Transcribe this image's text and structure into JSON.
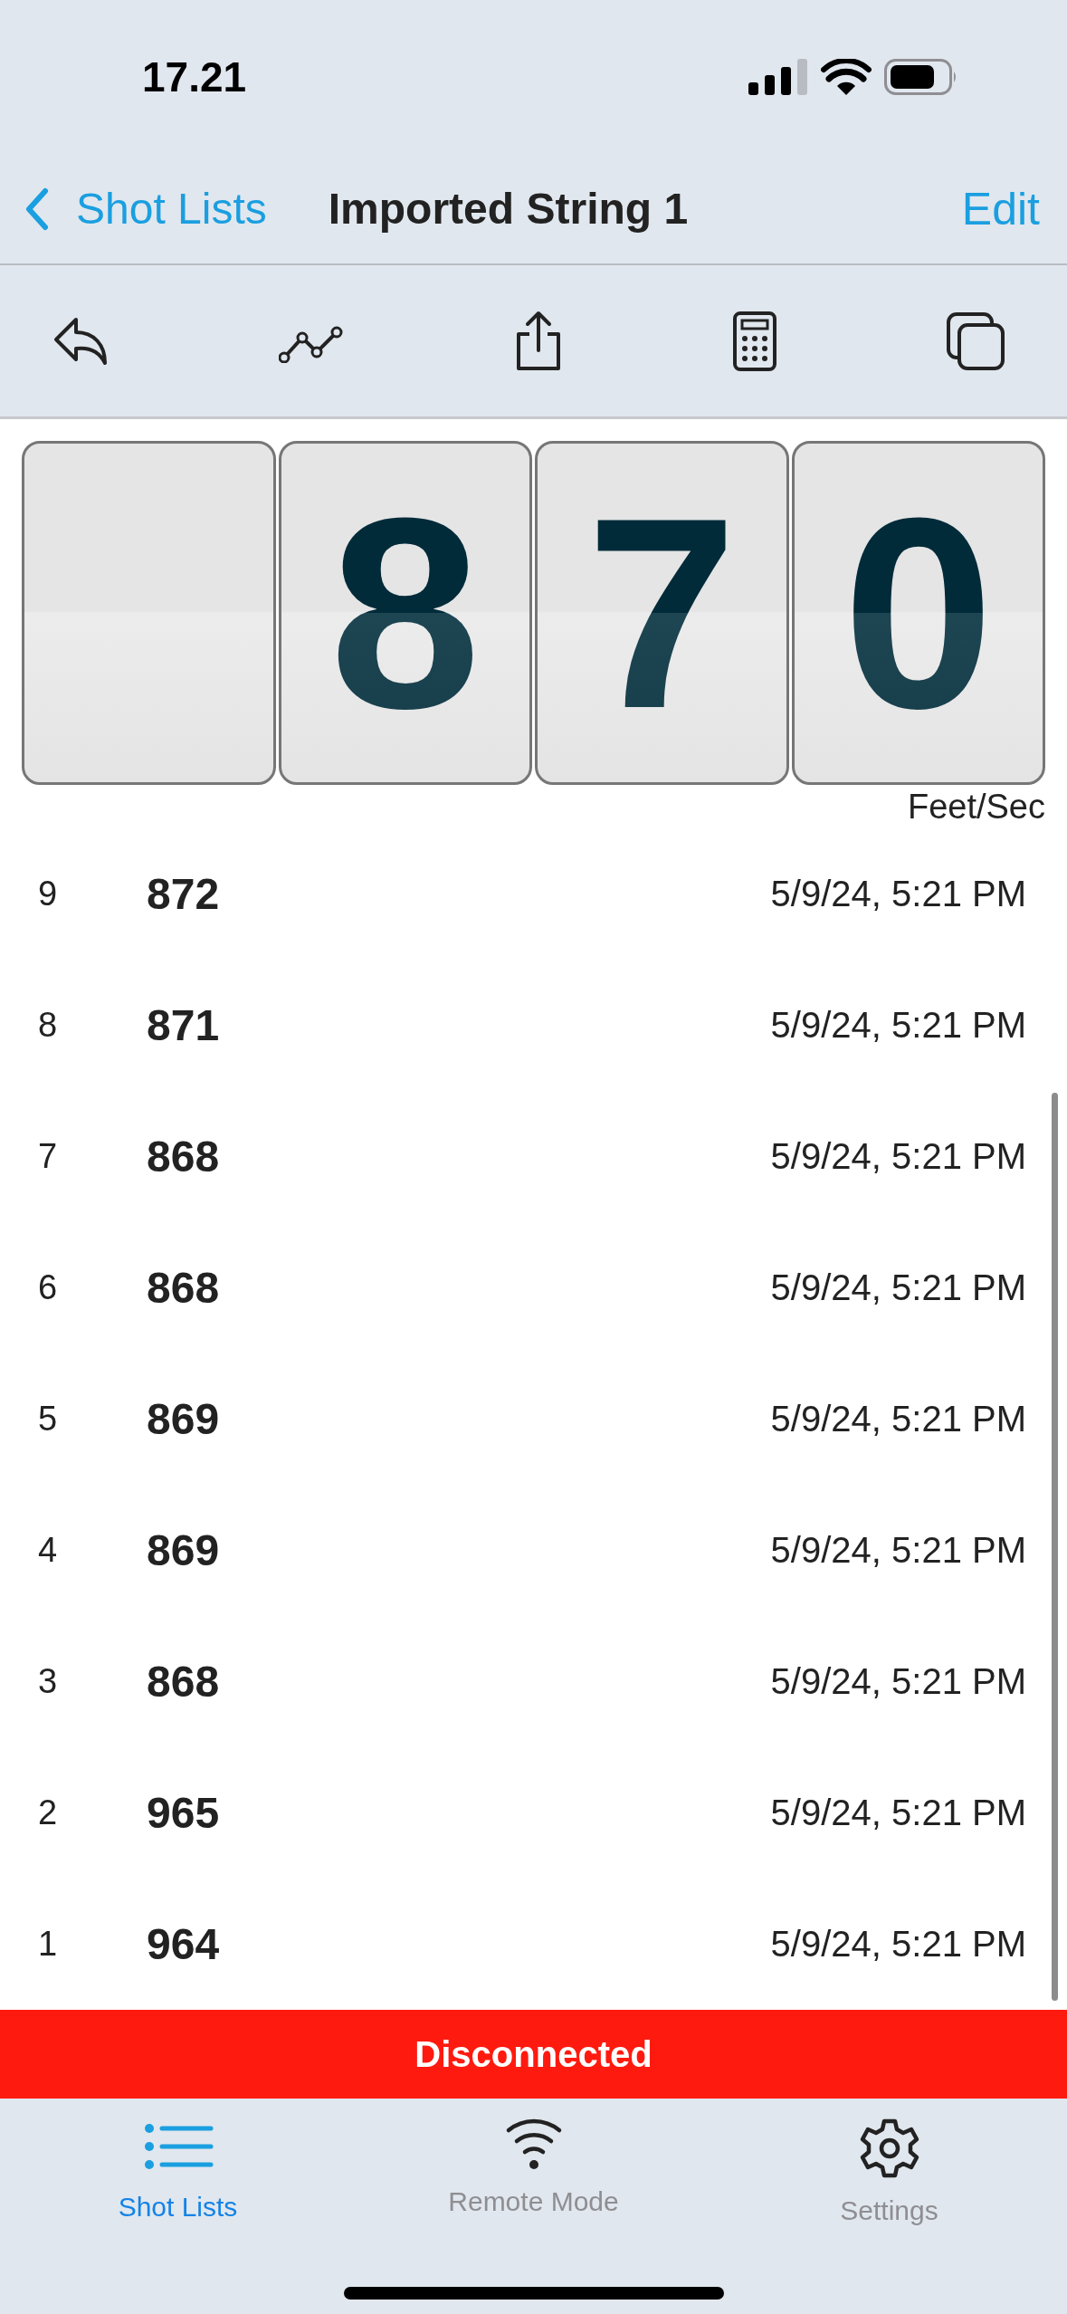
{
  "status_bar": {
    "time": "17.21"
  },
  "nav_bar": {
    "back": "Shot Lists",
    "title": "Imported String 1",
    "action": "Edit"
  },
  "toolbar": [
    {
      "kind": "reply"
    },
    {
      "kind": "chart"
    },
    {
      "kind": "share"
    },
    {
      "kind": "calculator"
    },
    {
      "kind": "copy"
    }
  ],
  "display": {
    "cards": [
      {
        "kind": "blank"
      },
      {
        "kind": "digit",
        "digit": "8"
      },
      {
        "kind": "digit",
        "digit": "7"
      },
      {
        "kind": "digit",
        "digit": "0"
      }
    ],
    "unit": "Feet/Sec"
  },
  "shots": [
    {
      "index": "9",
      "velocity": "872",
      "time": "5/9/24, 5:21 PM"
    },
    {
      "index": "8",
      "velocity": "871",
      "time": "5/9/24, 5:21 PM"
    },
    {
      "index": "7",
      "velocity": "868",
      "time": "5/9/24, 5:21 PM"
    },
    {
      "index": "6",
      "velocity": "868",
      "time": "5/9/24, 5:21 PM"
    },
    {
      "index": "5",
      "velocity": "869",
      "time": "5/9/24, 5:21 PM"
    },
    {
      "index": "4",
      "velocity": "869",
      "time": "5/9/24, 5:21 PM"
    },
    {
      "index": "3",
      "velocity": "868",
      "time": "5/9/24, 5:21 PM"
    },
    {
      "index": "2",
      "velocity": "965",
      "time": "5/9/24, 5:21 PM"
    },
    {
      "index": "1",
      "velocity": "964",
      "time": "5/9/24, 5:21 PM"
    }
  ],
  "connection_banner": "Disconnected",
  "tab_bar": [
    {
      "kind": "list",
      "label": "Shot Lists",
      "selected": true
    },
    {
      "kind": "wifi",
      "label": "Remote Mode",
      "selected": false
    },
    {
      "kind": "gear",
      "label": "Settings",
      "selected": false
    }
  ]
}
